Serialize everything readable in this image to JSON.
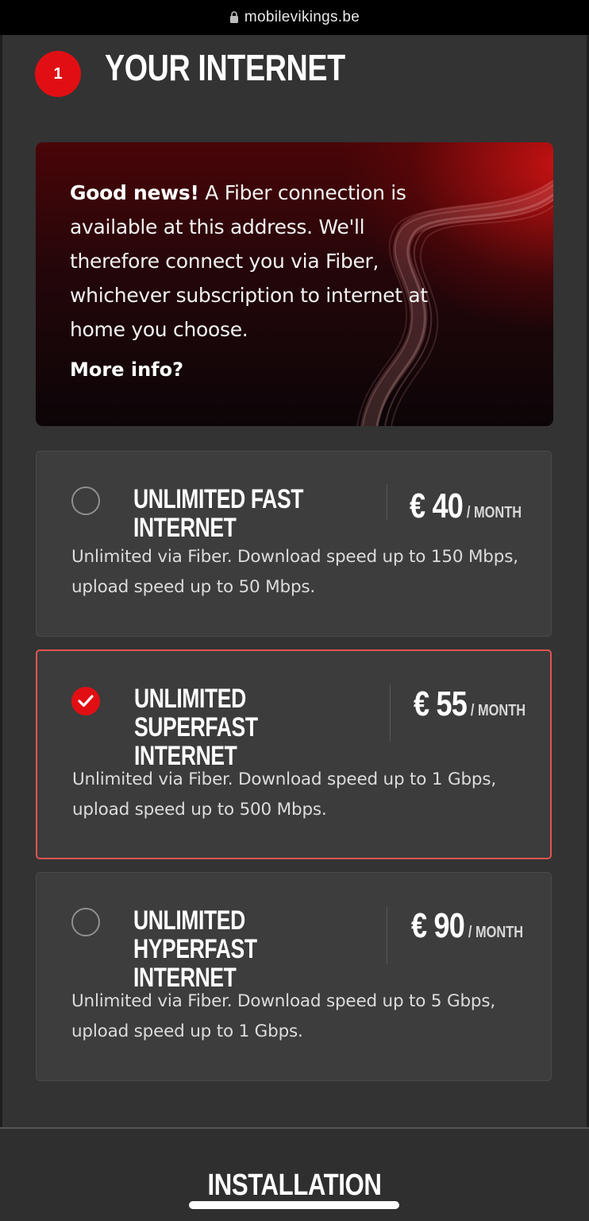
{
  "browser": {
    "url": "mobilevikings.be"
  },
  "section": {
    "step": "1",
    "title": "YOUR INTERNET"
  },
  "promo": {
    "headline": "Good news!",
    "body": " A Fiber connection is available at this address. We'll therefore connect you via Fiber, whichever subscription to internet at home you choose.",
    "link": "More info?"
  },
  "plans": [
    {
      "name": "UNLIMITED FAST INTERNET",
      "price": "€ 40",
      "per": "/ MONTH",
      "description": "Unlimited via Fiber. Download speed up to 150 Mbps, upload speed up to 50 Mbps.",
      "selected": false
    },
    {
      "name": "UNLIMITED SUPERFAST INTERNET",
      "price": "€ 55",
      "per": "/ MONTH",
      "description": "Unlimited via Fiber. Download speed up to 1 Gbps, upload speed up to 500 Mbps.",
      "selected": true
    },
    {
      "name": "UNLIMITED HYPERFAST INTERNET",
      "price": "€ 90",
      "per": "/ MONTH",
      "description": "Unlimited via Fiber. Download speed up to 5 Gbps, upload speed up to 1 Gbps.",
      "selected": false
    }
  ],
  "next_section": {
    "title": "INSTALLATION"
  },
  "colors": {
    "accent": "#e10f14",
    "background": "#333333",
    "card": "#3d3d3d",
    "selected_border": "#e0544f"
  }
}
